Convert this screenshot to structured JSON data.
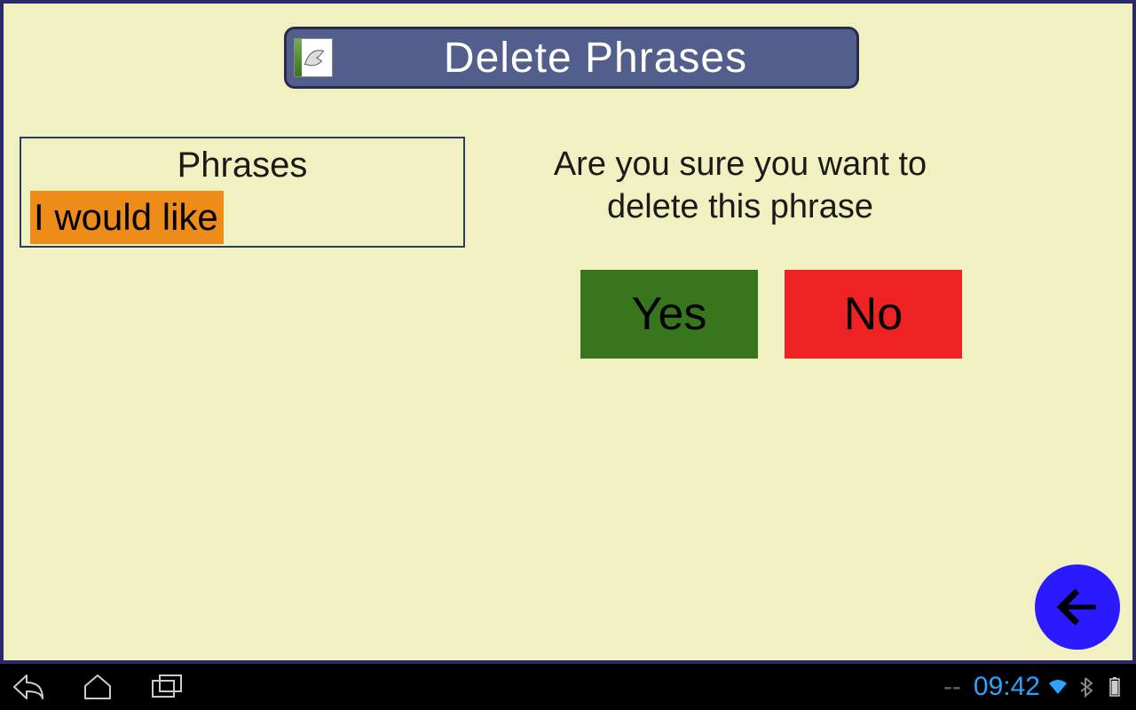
{
  "header": {
    "title": "Delete Phrases"
  },
  "phrases": {
    "heading": "Phrases",
    "items": [
      "I would like"
    ]
  },
  "confirm": {
    "message": "Are you sure you want to delete this phrase",
    "yes_label": "Yes",
    "no_label": "No"
  },
  "status": {
    "time": "09:42"
  }
}
